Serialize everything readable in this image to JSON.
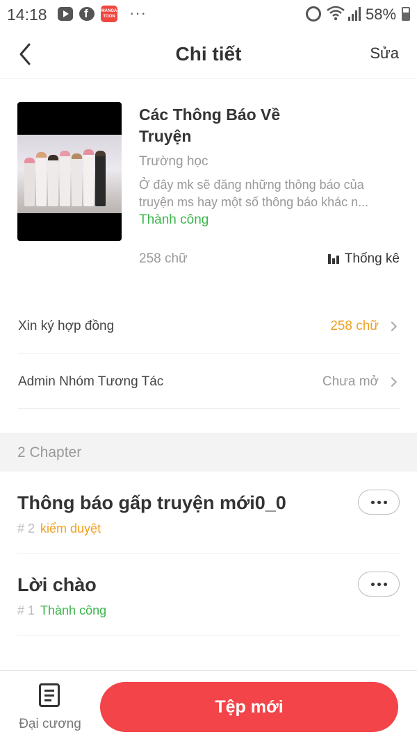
{
  "status_bar": {
    "time": "14:18",
    "battery": "58%",
    "app_badge": "MANGA TOON",
    "overflow": "···"
  },
  "header": {
    "title": "Chi tiết",
    "edit_label": "Sửa"
  },
  "book": {
    "title_line1": "Các Thông Báo Về",
    "title_line2": "Truyện",
    "genre": "Trường học",
    "description_line1": "Ở đây mk sẽ đăng những thông báo của",
    "description_line2": "truyện ms hay một số thông báo khác n...",
    "status": "Thành công",
    "word_count": "258 chữ",
    "stats_label": "Thống kê"
  },
  "settings": [
    {
      "label": "Xin ký hợp đồng",
      "value": "258 chữ",
      "value_color": "#f0a020"
    },
    {
      "label": "Admin Nhóm Tương Tác",
      "value": "Chưa mở",
      "value_color": "#999999"
    }
  ],
  "chapters_header": "2 Chapter",
  "chapters": [
    {
      "title": "Thông báo gấp truyện mới0_0",
      "number": "# 2",
      "status": "kiểm duyệt",
      "status_color": "#f0a020"
    },
    {
      "title": "Lời chào",
      "number": "# 1",
      "status": "Thành công",
      "status_color": "#3ab54a"
    }
  ],
  "bottom_bar": {
    "outline_label": "Đại cương",
    "new_chapter_label": "Tệp mới"
  },
  "colors": {
    "accent": "#f24449",
    "success": "#3ab54a",
    "warning": "#f0a020"
  }
}
